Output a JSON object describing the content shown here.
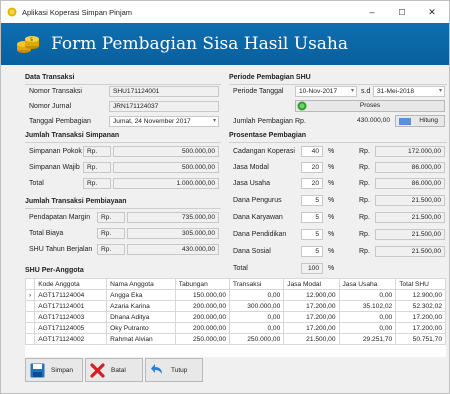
{
  "window": {
    "title": "Aplikasi Koperasi Simpan Pinjam",
    "min": "–",
    "max": "☐",
    "close": "✕"
  },
  "header": {
    "title": "Form Pembagian Sisa Hasil Usaha"
  },
  "data_transaksi": {
    "title": "Data Transaksi",
    "nomor_transaksi_label": "Nomor Transaksi",
    "nomor_transaksi": "SHU171124001",
    "nomor_jurnal_label": "Nomor Jurnal",
    "nomor_jurnal": "JRN171124037",
    "tanggal_label": "Tanggal Pembagian",
    "tanggal": "Jumat, 24 November 2017"
  },
  "periode": {
    "title": "Periode Pembagian SHU",
    "tanggal_label": "Periode Tanggal",
    "dari": "10-Nov-2017",
    "sd": "s.d",
    "sampai": "31-Mei-2018",
    "proses": "Proses",
    "jumlah_label": "Jumlah Pembagian",
    "rp": "Rp.",
    "jumlah": "430.000,00",
    "hitung": "Hitung"
  },
  "simpanan": {
    "title": "Jumlah Transaksi Simpanan",
    "rows": [
      {
        "label": "Simpanan Pokok",
        "rp": "Rp.",
        "value": "500.000,00"
      },
      {
        "label": "Simpanan Wajib",
        "rp": "Rp.",
        "value": "500.000,00"
      },
      {
        "label": "Total",
        "rp": "Rp.",
        "value": "1.000.000,00"
      }
    ]
  },
  "pembiayaan": {
    "title": "Jumlah Transaksi Pembiayaan",
    "rows": [
      {
        "label": "Pendapatan Margin",
        "rp": "Rp.",
        "value": "735.000,00"
      },
      {
        "label": "Total Biaya",
        "rp": "Rp.",
        "value": "305.000,00"
      },
      {
        "label": "SHU Tahun Berjalan",
        "rp": "Rp.",
        "value": "430.000,00"
      }
    ]
  },
  "prosentase": {
    "title": "Prosentase Pembagian",
    "rows": [
      {
        "label": "Cadangan Koperasi",
        "pct": "40",
        "sign": "%",
        "rp": "Rp.",
        "value": "172.000,00"
      },
      {
        "label": "Jasa Modal",
        "pct": "20",
        "sign": "%",
        "rp": "Rp.",
        "value": "86.000,00"
      },
      {
        "label": "Jasa Usaha",
        "pct": "20",
        "sign": "%",
        "rp": "Rp.",
        "value": "86.000,00"
      },
      {
        "label": "Dana Pengurus",
        "pct": "5",
        "sign": "%",
        "rp": "Rp.",
        "value": "21.500,00"
      },
      {
        "label": "Dana Karyawan",
        "pct": "5",
        "sign": "%",
        "rp": "Rp.",
        "value": "21.500,00"
      },
      {
        "label": "Dana Pendidikan",
        "pct": "5",
        "sign": "%",
        "rp": "Rp.",
        "value": "21.500,00"
      },
      {
        "label": "Dana Sosial",
        "pct": "5",
        "sign": "%",
        "rp": "Rp.",
        "value": "21.500,00"
      }
    ],
    "total_label": "Total",
    "total_pct": "100",
    "total_sign": "%"
  },
  "shu": {
    "title": "SHU Per-Anggota",
    "columns": [
      "Kode Anggota",
      "Nama Anggota",
      "Tabungan",
      "Transaksi",
      "Jasa Modal",
      "Jasa Usaha",
      "Total SHU"
    ],
    "rows": [
      {
        "sel": "›",
        "kode": "AGT171124004",
        "nama": "Angga Eka",
        "tab": "150.000,00",
        "trx": "0,00",
        "jm": "12.900,00",
        "ju": "0,00",
        "tot": "12.900,00"
      },
      {
        "sel": "",
        "kode": "AGT171124001",
        "nama": "Azaria Karina",
        "tab": "200.000,00",
        "trx": "300.000,00",
        "jm": "17.200,00",
        "ju": "35.102,02",
        "tot": "52.302,02"
      },
      {
        "sel": "",
        "kode": "AGT171124003",
        "nama": "Dhana Aditya",
        "tab": "200.000,00",
        "trx": "0,00",
        "jm": "17.200,00",
        "ju": "0,00",
        "tot": "17.200,00"
      },
      {
        "sel": "",
        "kode": "AGT171124005",
        "nama": "Oky Putranto",
        "tab": "200.000,00",
        "trx": "0,00",
        "jm": "17.200,00",
        "ju": "0,00",
        "tot": "17.200,00"
      },
      {
        "sel": "",
        "kode": "AGT171124002",
        "nama": "Rahmat Alvian",
        "tab": "250.000,00",
        "trx": "250.000,00",
        "jm": "21.500,00",
        "ju": "29.251,70",
        "tot": "50.751,70"
      }
    ]
  },
  "actions": {
    "simpan": "Simpan",
    "batal": "Batal",
    "tutup": "Tutup"
  },
  "colors": {
    "header": "#0d6fb2",
    "accent": "#2e9e2e"
  },
  "icons": [
    "coins-icon",
    "save-icon",
    "cancel-icon",
    "back-arrow-icon",
    "calculator-icon",
    "proses-icon"
  ]
}
